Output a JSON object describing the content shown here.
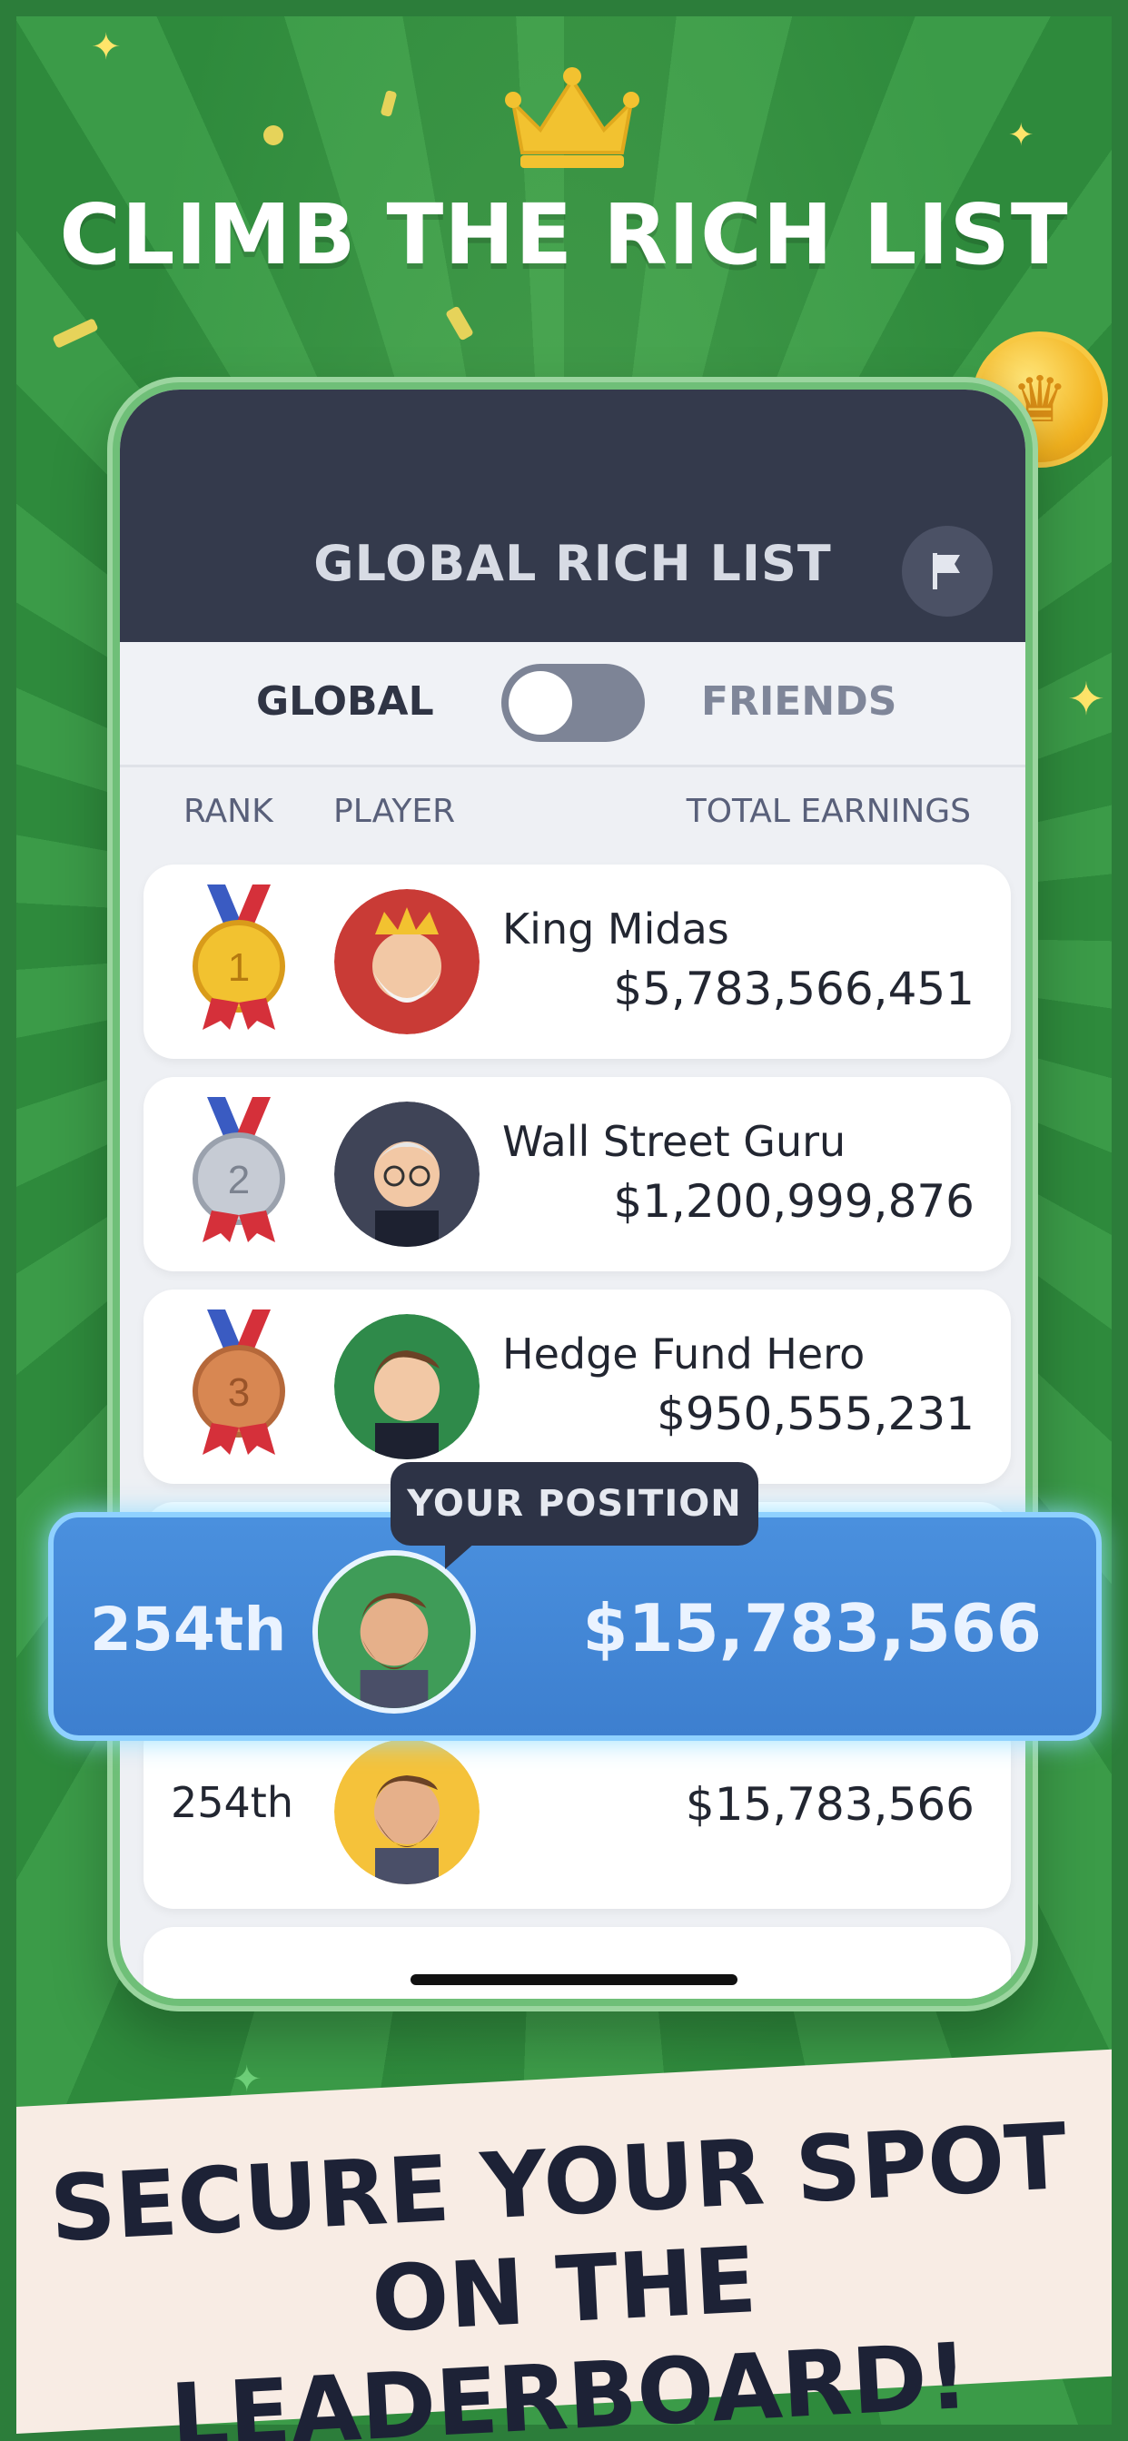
{
  "headline": "CLIMB THE RICH LIST",
  "app": {
    "title": "GLOBAL RICH LIST",
    "toggle": {
      "left_label": "GLOBAL",
      "right_label": "FRIENDS"
    },
    "columns": {
      "rank": "RANK",
      "player": "PLAYER",
      "earnings": "TOTAL EARNINGS"
    },
    "leaders": [
      {
        "rank": "1",
        "name": "King Midas",
        "earnings": "$5,783,566,451",
        "medal_color": "#f2c230"
      },
      {
        "rank": "2",
        "name": "Wall Street Guru",
        "earnings": "$1,200,999,876",
        "medal_color": "#c6cbd4"
      },
      {
        "rank": "3",
        "name": "Hedge Fund Hero",
        "earnings": "$950,555,231",
        "medal_color": "#d88752"
      }
    ],
    "your_position": {
      "tooltip": "YOUR POSITION",
      "rank": "254th",
      "earnings": "$15,783,566"
    },
    "row_below": {
      "rank": "254th",
      "earnings": "$15,783,566"
    }
  },
  "banner": {
    "line1": "SECURE YOUR SPOT",
    "line2": "ON THE LEADERBOARD!"
  },
  "icons": [
    "crown-icon",
    "coin-icon",
    "flag-icon",
    "medal-icon",
    "avatar-icon",
    "sparkle-icon"
  ]
}
